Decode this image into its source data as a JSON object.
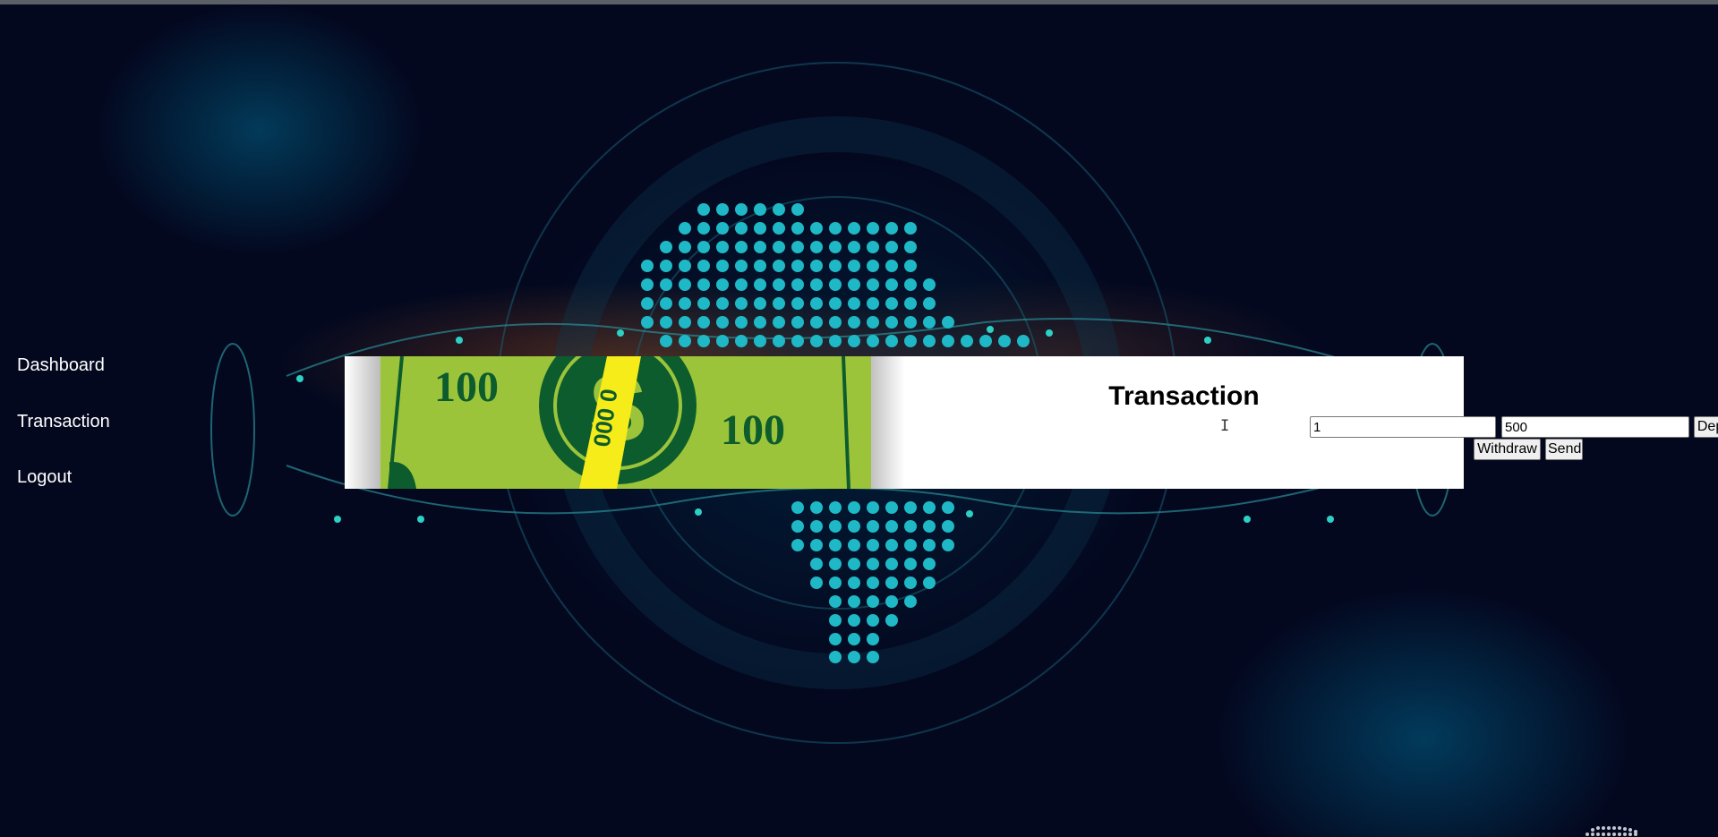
{
  "nav": {
    "items": [
      {
        "label": "Dashboard"
      },
      {
        "label": "Transaction"
      },
      {
        "label": "Logout"
      }
    ]
  },
  "banner": {
    "denomination_left": "100",
    "denomination_right": "100",
    "currency_symbol": "$",
    "serial": "000 0"
  },
  "transaction": {
    "title": "Transaction",
    "account_value": "1",
    "amount_value": "500",
    "deposit_label": "Deposit",
    "withdraw_label": "Withdraw",
    "send_label": "Send"
  },
  "colors": {
    "background": "#03081f",
    "dots": "#1fb8c6",
    "bill_green": "#9cc43a",
    "bill_dark": "#0d5c2e",
    "stripe_yellow": "#f5ec1a"
  }
}
